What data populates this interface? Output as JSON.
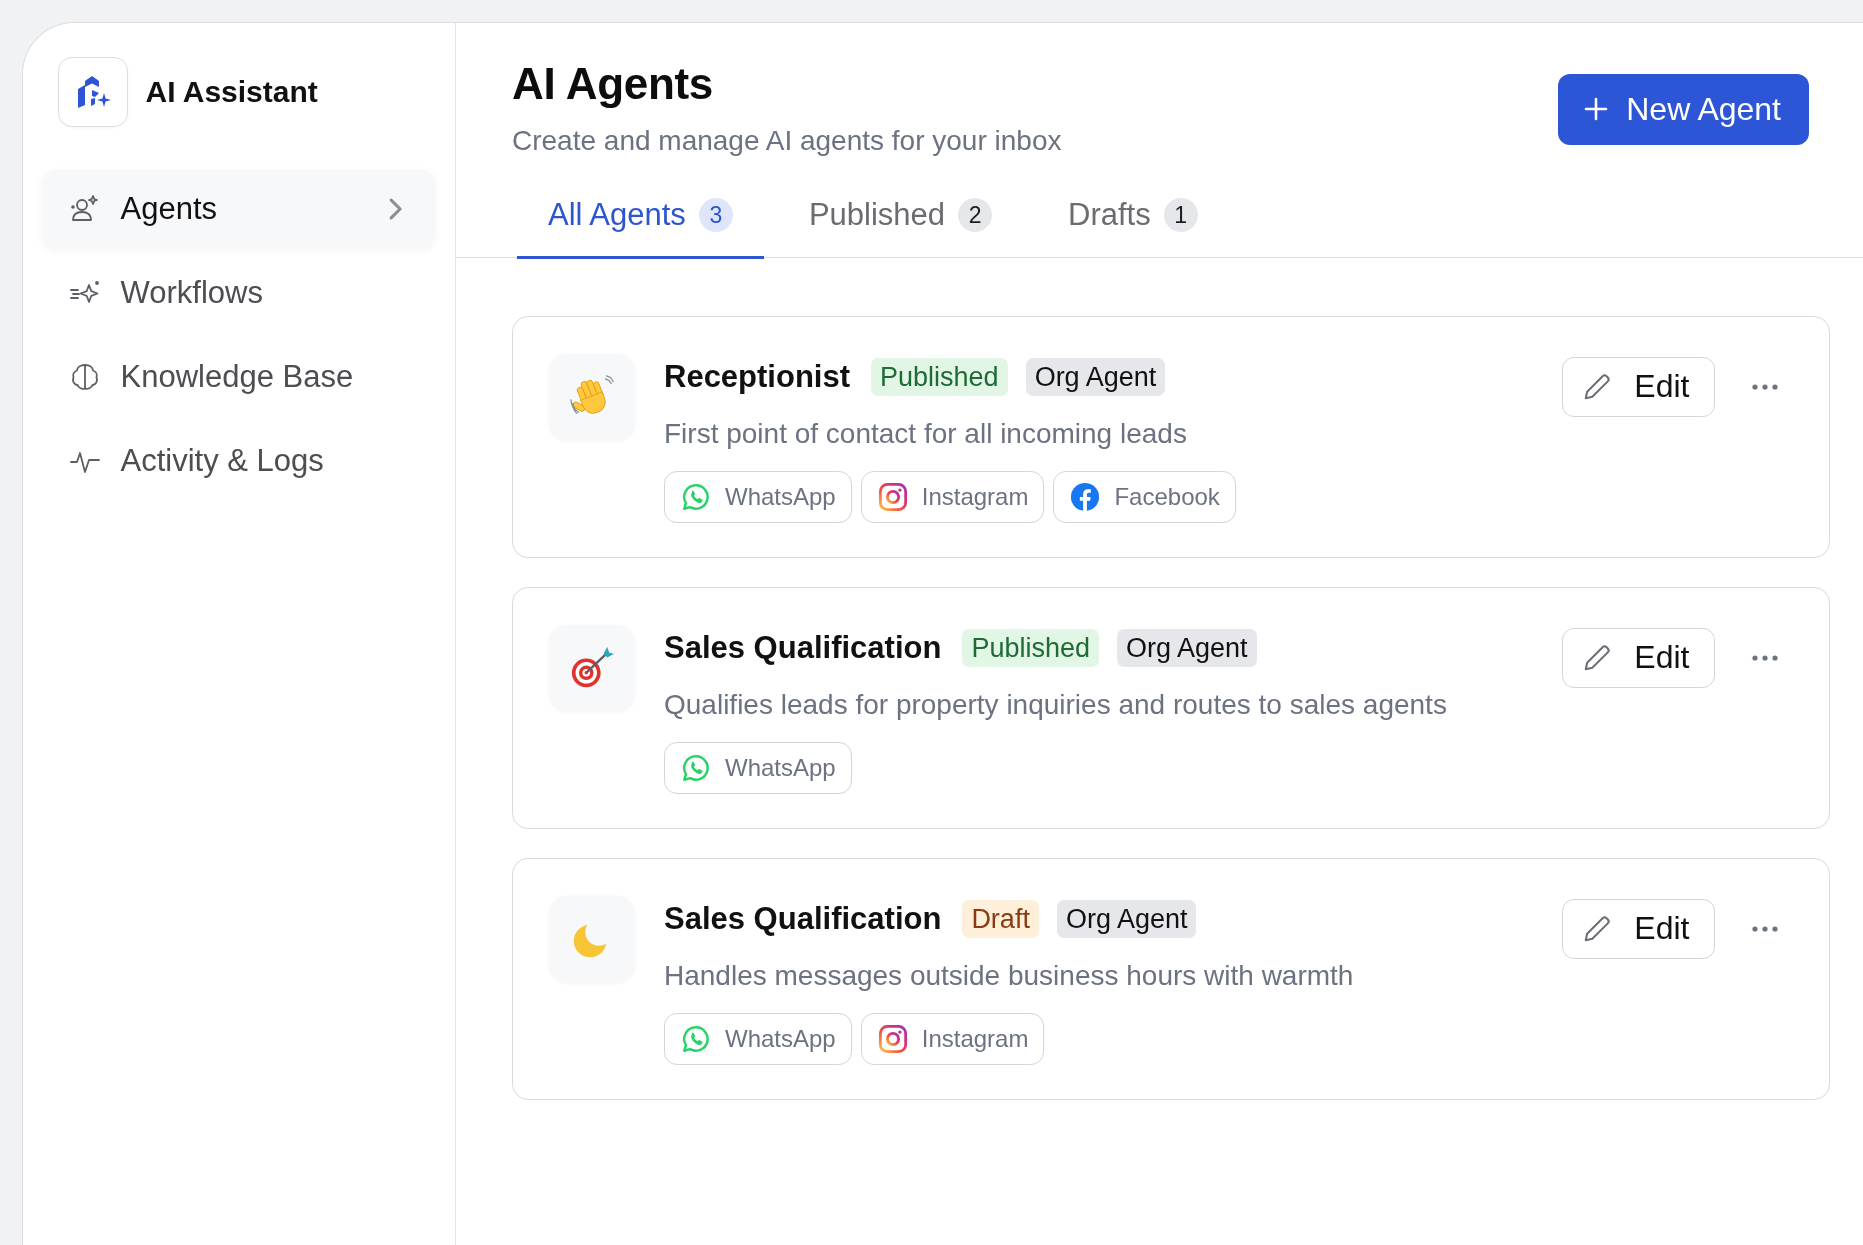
{
  "sidebar": {
    "title": "AI Assistant",
    "items": [
      {
        "label": "Agents",
        "kind": "agents",
        "selected": true
      },
      {
        "label": "Workflows",
        "kind": "workflows",
        "selected": false
      },
      {
        "label": "Knowledge Base",
        "kind": "knowledge",
        "selected": false
      },
      {
        "label": "Activity & Logs",
        "kind": "activity",
        "selected": false
      }
    ]
  },
  "header": {
    "title": "AI Agents",
    "subtitle": "Create and manage AI agents for your inbox",
    "action": "New Agent"
  },
  "tabs": [
    {
      "label": "All Agents",
      "count": "3",
      "selected": true
    },
    {
      "label": "Published",
      "count": "2",
      "selected": false
    },
    {
      "label": "Drafts",
      "count": "1",
      "selected": false
    }
  ],
  "agents": [
    {
      "kind": "wave",
      "name": "Receptionist",
      "status": {
        "label": "Published",
        "kind": "published"
      },
      "scope": "Org Agent",
      "description": "First point of contact for all incoming leads",
      "channels": [
        {
          "kind": "whatsapp",
          "label": "WhatsApp"
        },
        {
          "kind": "instagram",
          "label": "Instagram"
        },
        {
          "kind": "facebook",
          "label": "Facebook"
        }
      ],
      "edit": "Edit"
    },
    {
      "kind": "target",
      "name": "Sales Qualification",
      "status": {
        "label": "Published",
        "kind": "published"
      },
      "scope": "Org Agent",
      "description": "Qualifies leads for property inquiries and routes to sales agents",
      "channels": [
        {
          "kind": "whatsapp",
          "label": "WhatsApp"
        }
      ],
      "edit": "Edit"
    },
    {
      "kind": "moon",
      "name": "Sales Qualification",
      "status": {
        "label": "Draft",
        "kind": "draft"
      },
      "scope": "Org Agent",
      "description": "Handles messages outside business hours with warmth",
      "channels": [
        {
          "kind": "whatsapp",
          "label": "WhatsApp"
        },
        {
          "kind": "instagram",
          "label": "Instagram"
        }
      ],
      "edit": "Edit"
    }
  ]
}
